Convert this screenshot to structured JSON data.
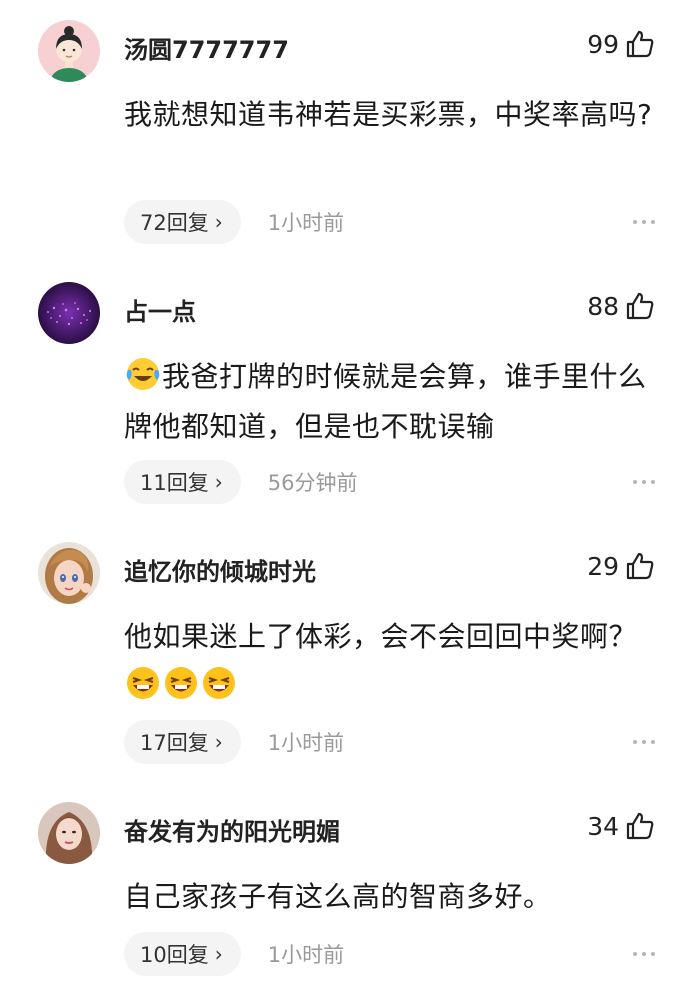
{
  "comments": [
    {
      "username": "汤圆7777777",
      "likes": "99",
      "text": "我就想知道韦神若是买彩票，中奖率高吗?",
      "reply_label": "72回复",
      "time": "1小时前"
    },
    {
      "username": "占一点",
      "likes": "88",
      "text": "我爸打牌的时候就是会算，谁手里什么牌他都知道，但是也不耽误输",
      "reply_label": "11回复",
      "time": "56分钟前"
    },
    {
      "username": "追忆你的倾城时光",
      "likes": "29",
      "text": "他如果迷上了体彩，会不会回回中奖啊？",
      "reply_label": "17回复",
      "time": "1小时前"
    },
    {
      "username": "奋发有为的阳光明媚",
      "likes": "34",
      "text": "自己家孩子有这么高的智商多好。",
      "reply_label": "10回复",
      "time": "1小时前"
    }
  ],
  "icons": {
    "like": "thumbs-up-icon",
    "more": "more-dots-icon",
    "reply": "chevron-right-icon",
    "cry_laugh": "crying-laughing-emoji",
    "grin_laugh": "laughing-emoji"
  },
  "reply_chevron": "›"
}
